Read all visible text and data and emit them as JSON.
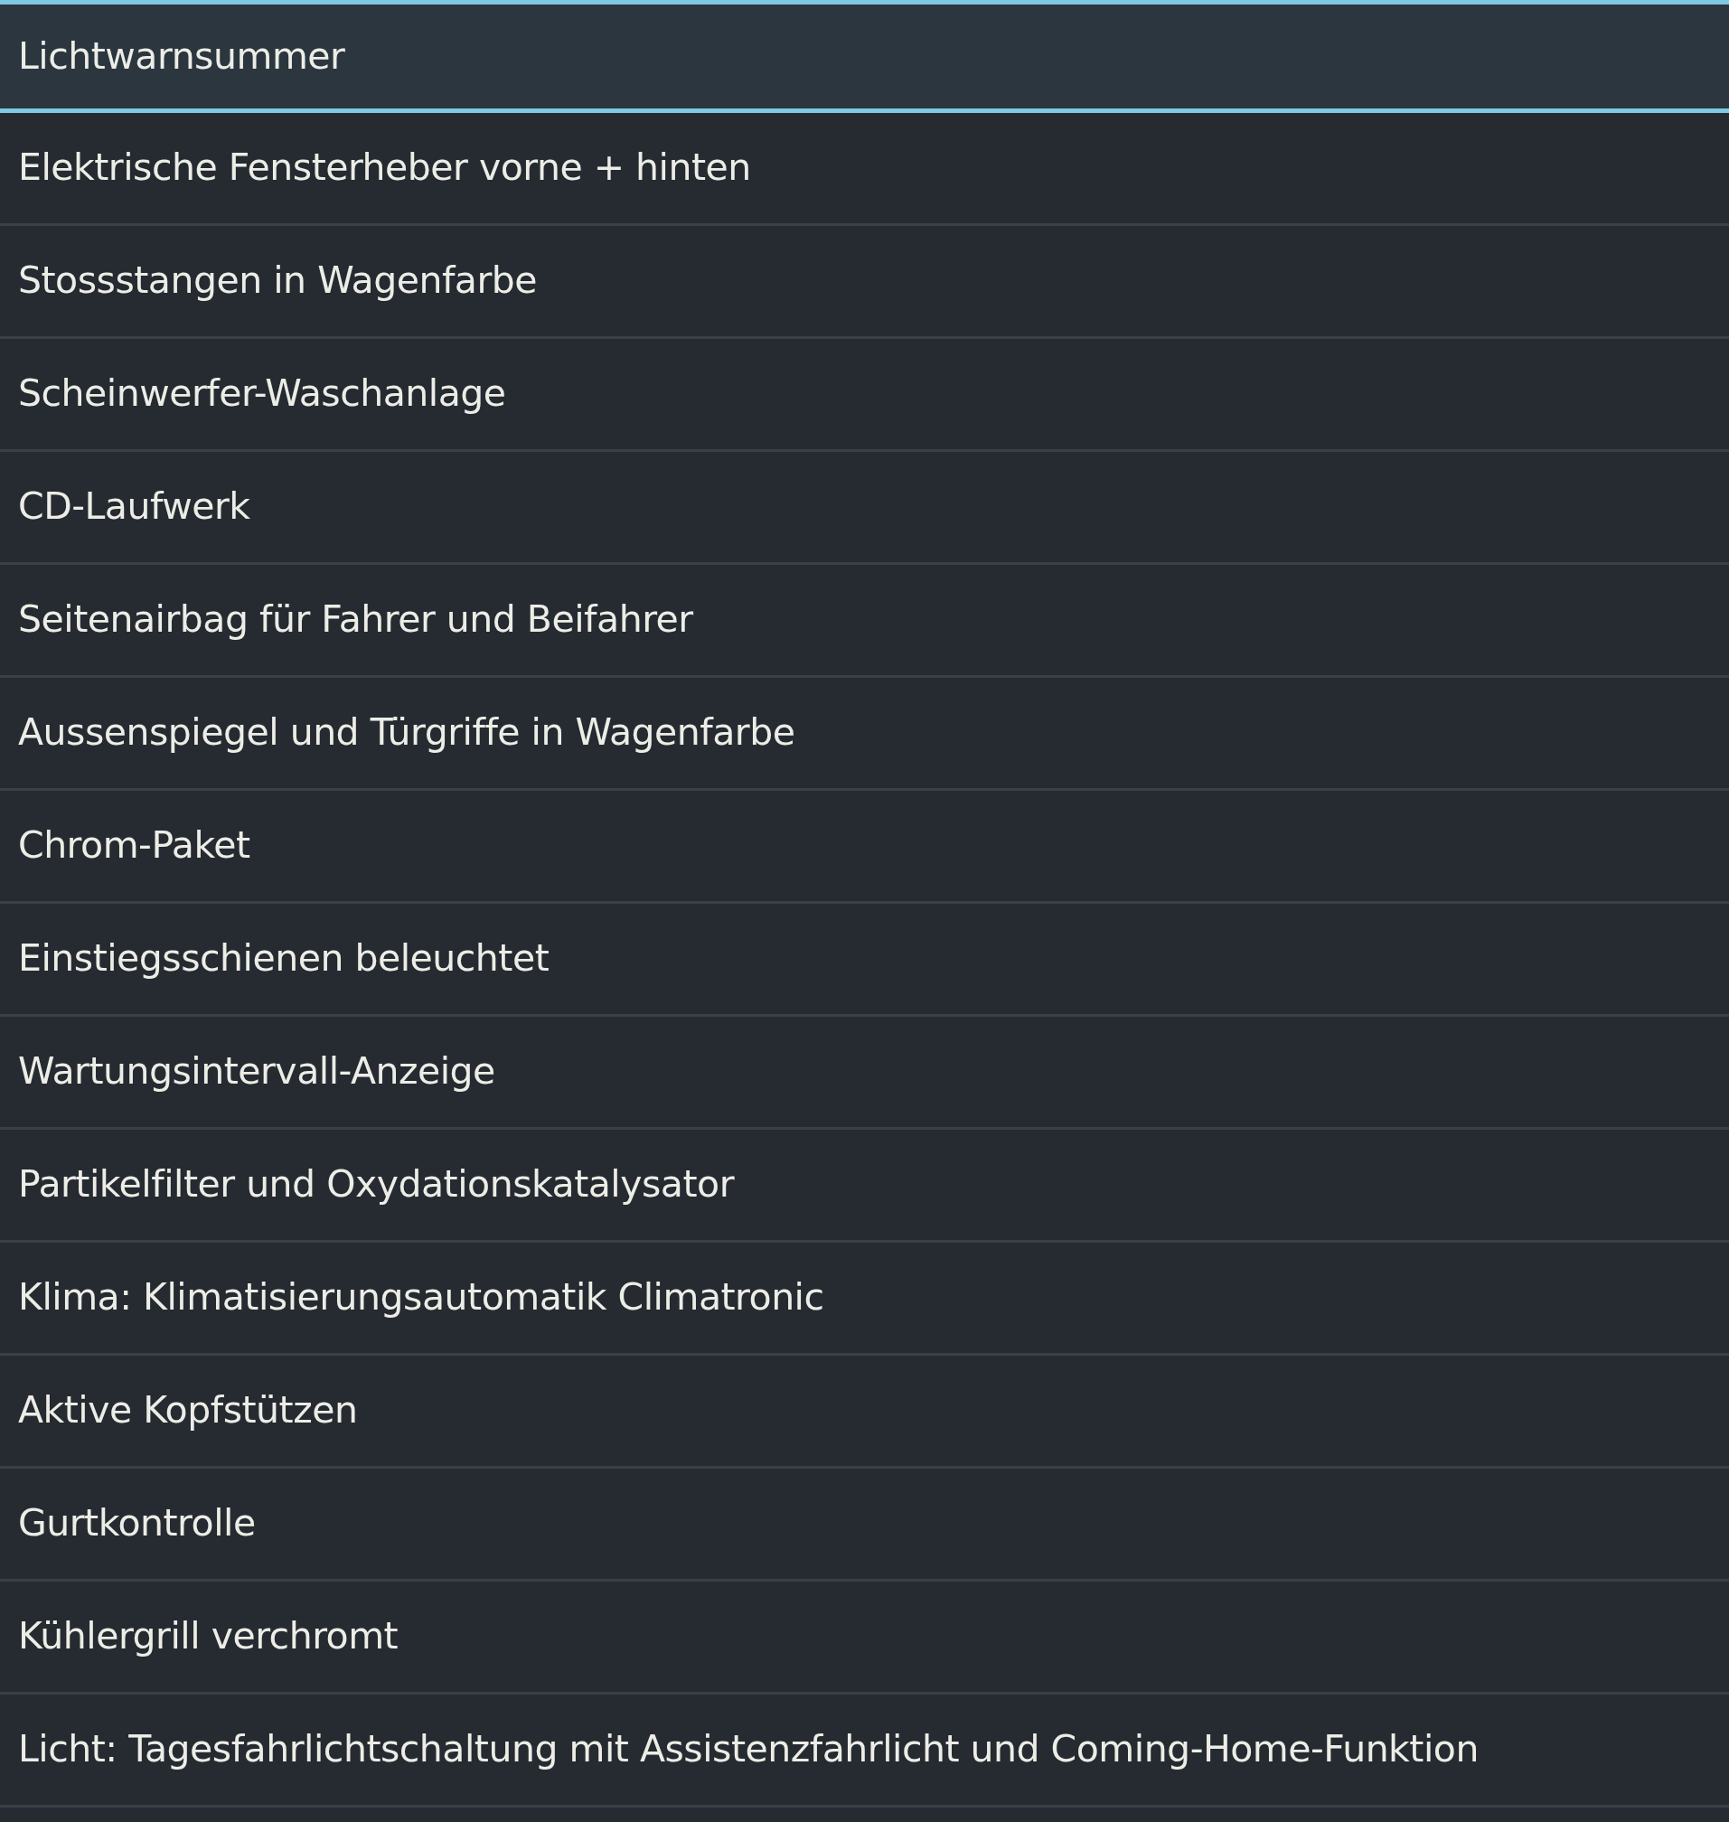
{
  "items": [
    {
      "label": "Lichtwarnsummer",
      "selected": true
    },
    {
      "label": "Elektrische Fensterheber vorne + hinten",
      "selected": false
    },
    {
      "label": "Stossstangen in Wagenfarbe",
      "selected": false
    },
    {
      "label": "Scheinwerfer-Waschanlage",
      "selected": false
    },
    {
      "label": "CD-Laufwerk",
      "selected": false
    },
    {
      "label": "Seitenairbag für Fahrer und Beifahrer",
      "selected": false
    },
    {
      "label": "Aussenspiegel und Türgriffe in Wagenfarbe",
      "selected": false
    },
    {
      "label": "Chrom-Paket",
      "selected": false
    },
    {
      "label": "Einstiegsschienen beleuchtet",
      "selected": false
    },
    {
      "label": "Wartungsintervall-Anzeige",
      "selected": false
    },
    {
      "label": "Partikelfilter und Oxydationskatalysator",
      "selected": false
    },
    {
      "label": "Klima: Klimatisierungsautomatik Climatronic",
      "selected": false
    },
    {
      "label": "Aktive Kopfstützen",
      "selected": false
    },
    {
      "label": "Gurtkontrolle",
      "selected": false
    },
    {
      "label": "Kühlergrill verchromt",
      "selected": false
    },
    {
      "label": "Licht: Tagesfahrlichtschaltung mit Assistenzfahrlicht und Coming-Home-Funktion",
      "selected": false
    }
  ]
}
